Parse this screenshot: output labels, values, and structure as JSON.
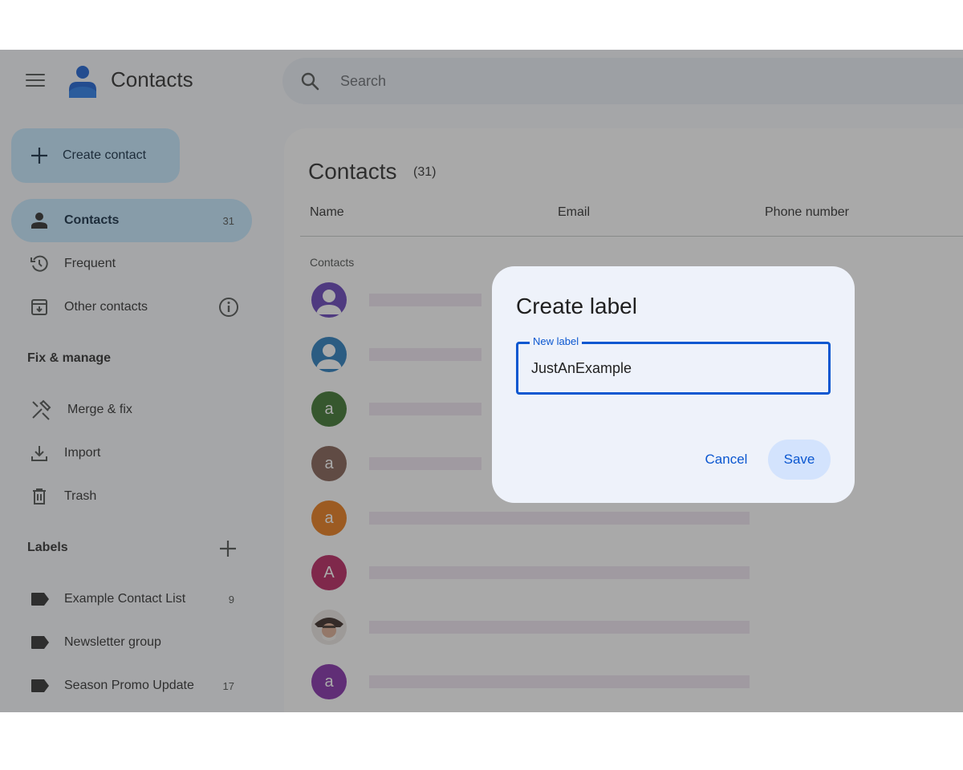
{
  "header": {
    "app_title": "Contacts",
    "menu_icon": "hamburger-menu-icon",
    "logo_icon": "contacts-person-logo",
    "search_placeholder": "Search"
  },
  "sidebar": {
    "create_label": "Create contact",
    "nav": [
      {
        "label": "Contacts",
        "count": "31",
        "icon": "person-icon",
        "active": true
      },
      {
        "label": "Frequent",
        "count": "",
        "icon": "history-icon"
      },
      {
        "label": "Other contacts",
        "count": "",
        "icon": "archive-download-icon"
      }
    ],
    "fix_manage_heading": "Fix & manage",
    "tools": [
      {
        "label": "Merge & fix",
        "icon": "merge-fix-icon"
      },
      {
        "label": "Import",
        "icon": "import-icon"
      },
      {
        "label": "Trash",
        "icon": "trash-icon"
      }
    ],
    "labels_heading": "Labels",
    "labels": [
      {
        "label": "Example Contact List",
        "count": "9"
      },
      {
        "label": "Newsletter group",
        "count": ""
      },
      {
        "label": "Season Promo Update",
        "count": "17"
      }
    ]
  },
  "main": {
    "title": "Contacts",
    "count": "(31)",
    "columns": [
      "Name",
      "Email",
      "Phone number"
    ],
    "group_label": "Contacts",
    "rows": [
      {
        "initial": "",
        "color": "#5b35b5",
        "photo": "default-avatar"
      },
      {
        "initial": "",
        "color": "#1a73b8",
        "photo": "default-avatar"
      },
      {
        "initial": "a",
        "color": "#2e6b1f",
        "photo": ""
      },
      {
        "initial": "a",
        "color": "#7a5548",
        "photo": ""
      },
      {
        "initial": "a",
        "color": "#e8710a",
        "photo": ""
      },
      {
        "initial": "A",
        "color": "#b31455",
        "photo": ""
      },
      {
        "initial": "",
        "color": "#6d4c41",
        "photo": "photo-avatar"
      },
      {
        "initial": "a",
        "color": "#7b1fa2",
        "photo": ""
      }
    ]
  },
  "dialog": {
    "title": "Create label",
    "field_label": "New label",
    "field_value": "JustAnExample",
    "cancel_label": "Cancel",
    "save_label": "Save"
  },
  "colors": {
    "accent": "#0b57d0",
    "active_nav": "#c2e7ff",
    "scrim": "rgba(64,64,64,0.45)"
  }
}
